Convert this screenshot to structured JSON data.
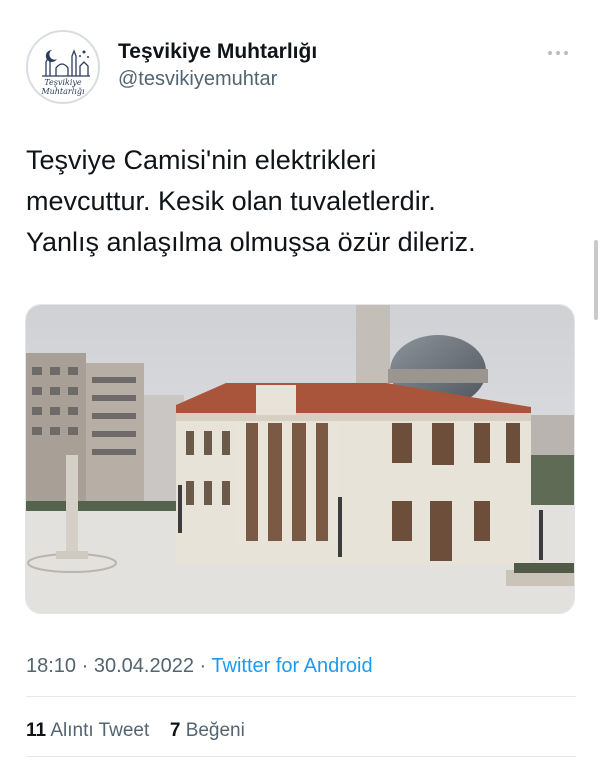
{
  "author": {
    "display_name": "Teşvikiye Muhtarlığı",
    "handle": "@tesvikiyemuhtar",
    "avatar_text": [
      "Teşvikiye",
      "Muhtarlığı"
    ],
    "avatar_icon": "mosque-skyline-logo"
  },
  "more_icon": "more-horizontal-icon",
  "tweet": {
    "text": "Teşviye Camisi'nin elektrikleri\nmevcuttur. Kesik olan tuvaletlerdir.\nYanlış anlaşılma olmuşsa özür dileriz.",
    "photo_icon": "mosque-photo"
  },
  "meta": {
    "time": "18:10",
    "separator": "·",
    "date": "30.04.2022",
    "source": "Twitter for Android"
  },
  "stats": {
    "quote_count": "11",
    "quote_label": "Alıntı Tweet",
    "like_count": "7",
    "like_label": "Beğeni"
  },
  "colors": {
    "link": "#1d9bf0",
    "secondary_text": "#536471",
    "primary_text": "#0f1419"
  }
}
